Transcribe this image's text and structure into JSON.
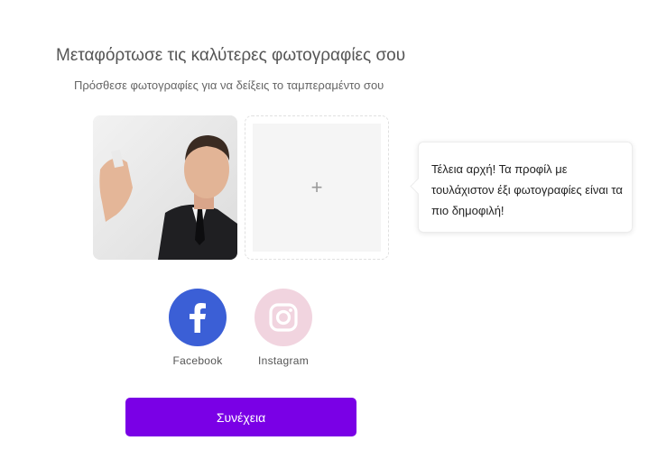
{
  "header": {
    "title": "Μεταφόρτωσε τις καλύτερες φωτογραφίες σου",
    "subtitle": "Πρόσθεσε φωτογραφίες για να δείξεις το ταμπεραμέντο σου"
  },
  "photos": {
    "uploaded": [
      {
        "icon": "profile-photo"
      }
    ],
    "add_slot": {
      "icon": "plus-icon",
      "symbol": "+"
    }
  },
  "tip": {
    "text": "Τέλεια αρχή! Τα προφίλ με τουλάχιστον έξι φωτογραφίες είναι τα πιο δημοφιλή!"
  },
  "social": {
    "items": [
      {
        "label": "Facebook",
        "icon": "facebook-icon",
        "color": "#3b5fd6"
      },
      {
        "label": "Instagram",
        "icon": "instagram-icon",
        "color": "#f1d4df"
      }
    ]
  },
  "actions": {
    "continue_label": "Συνέχεια",
    "continue_color": "#7a00e6"
  }
}
